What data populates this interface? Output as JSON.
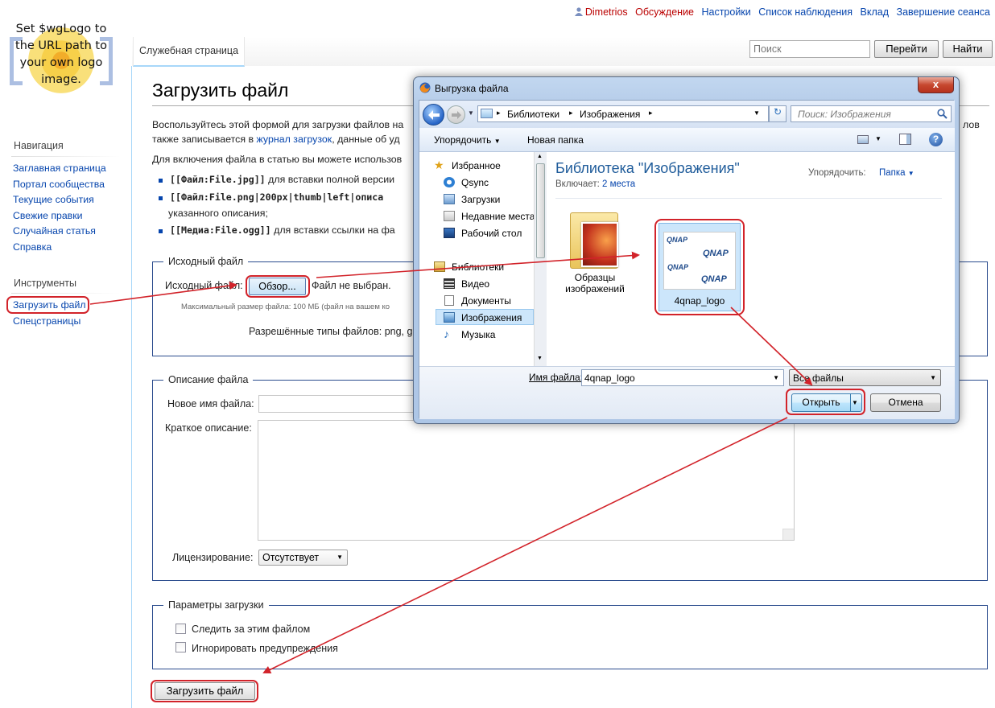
{
  "personal": {
    "user": "Dimetrios",
    "talk": "Обсуждение",
    "prefs": "Настройки",
    "watchlist": "Список наблюдения",
    "contribs": "Вклад",
    "logout": "Завершение сеанса"
  },
  "logo": {
    "text": "Set $wgLogo to the URL path to your own logo image."
  },
  "nav": {
    "heading": "Навигация",
    "items": [
      "Заглавная страница",
      "Портал сообщества",
      "Текущие события",
      "Свежие правки",
      "Случайная статья",
      "Справка"
    ]
  },
  "tools": {
    "heading": "Инструменты",
    "items": [
      "Загрузить файл",
      "Спецстраницы"
    ]
  },
  "tabs": {
    "special": "Служебная страница"
  },
  "search": {
    "placeholder": "Поиск",
    "go": "Перейти",
    "find": "Найти"
  },
  "page": {
    "title": "Загрузить файл",
    "intro_line1_start": "Воспользуйтесь этой формой для загрузки файлов на",
    "intro_line1_end": "лов",
    "intro_line2_start": "также записывается в ",
    "intro_link": "журнал загрузок",
    "intro_line2_end": ", данные об уд",
    "intro_line3": "Для включения файла в статью вы можете использов",
    "b1_code": "[[Файл:File.jpg]]",
    "b1_text": " для вставки полной версии",
    "b2_code": "[[Файл:File.png|200px|thumb|left|описа",
    "b2_cont": "указанного описания;",
    "b3_code": "[[Медиа:File.ogg]]",
    "b3_text": " для вставки ссылки на фа"
  },
  "source": {
    "legend": "Исходный файл",
    "label": "Исходный файл:",
    "browse": "Обзор...",
    "no_file": "Файл не выбран.",
    "max_size": "Максимальный размер файла: 100 МБ (файл на вашем ко",
    "types": "Разрешённые типы файлов: png, g"
  },
  "desc": {
    "legend": "Описание файла",
    "new_name": "Новое имя файла:",
    "summary": "Краткое описание:",
    "license": "Лицензирование:",
    "license_value": "Отсутствует"
  },
  "params": {
    "legend": "Параметры загрузки",
    "watch": "Следить за этим файлом",
    "ignore": "Игнорировать предупреждения"
  },
  "upload_button": "Загрузить файл",
  "dialog": {
    "title": "Выгрузка файла",
    "close": "x",
    "breadcrumb": [
      "Библиотеки",
      "Изображения"
    ],
    "search_placeholder": "Поиск: Изображения",
    "organize": "Упорядочить",
    "new_folder": "Новая папка",
    "favorites": "Избранное",
    "fav_items": [
      "Qsync",
      "Загрузки",
      "Недавние места",
      "Рабочий стол"
    ],
    "libraries": "Библиотеки",
    "lib_items": [
      "Видео",
      "Документы",
      "Изображения",
      "Музыка"
    ],
    "lib_title": "Библиотека \"Изображения\"",
    "includes_label": "Включает:",
    "includes_link": "2 места",
    "arrange_label": "Упорядочить:",
    "arrange_value": "Папка",
    "folder_name": "Образцы изображений",
    "file_name": "4qnap_logo",
    "logo_text": "QNAP",
    "filename_label": "Имя файла:",
    "filename_value": "4qnap_logo",
    "filter": "Все файлы",
    "open": "Открыть",
    "cancel": "Отмена"
  },
  "colors": {
    "link": "#0645ad",
    "annotation": "#d2232a",
    "fieldset": "#2a4b8d"
  }
}
